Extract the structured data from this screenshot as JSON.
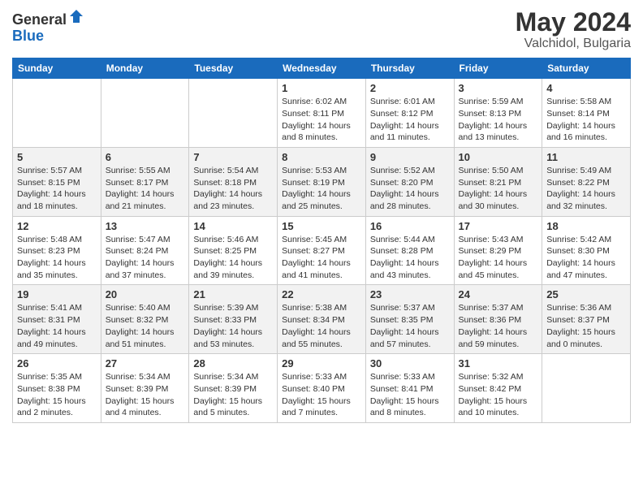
{
  "logo": {
    "general": "General",
    "blue": "Blue"
  },
  "header": {
    "month_year": "May 2024",
    "location": "Valchidol, Bulgaria"
  },
  "weekdays": [
    "Sunday",
    "Monday",
    "Tuesday",
    "Wednesday",
    "Thursday",
    "Friday",
    "Saturday"
  ],
  "weeks": [
    [
      {
        "day": "",
        "sunrise": "",
        "sunset": "",
        "daylight": ""
      },
      {
        "day": "",
        "sunrise": "",
        "sunset": "",
        "daylight": ""
      },
      {
        "day": "",
        "sunrise": "",
        "sunset": "",
        "daylight": ""
      },
      {
        "day": "1",
        "sunrise": "Sunrise: 6:02 AM",
        "sunset": "Sunset: 8:11 PM",
        "daylight": "Daylight: 14 hours and 8 minutes."
      },
      {
        "day": "2",
        "sunrise": "Sunrise: 6:01 AM",
        "sunset": "Sunset: 8:12 PM",
        "daylight": "Daylight: 14 hours and 11 minutes."
      },
      {
        "day": "3",
        "sunrise": "Sunrise: 5:59 AM",
        "sunset": "Sunset: 8:13 PM",
        "daylight": "Daylight: 14 hours and 13 minutes."
      },
      {
        "day": "4",
        "sunrise": "Sunrise: 5:58 AM",
        "sunset": "Sunset: 8:14 PM",
        "daylight": "Daylight: 14 hours and 16 minutes."
      }
    ],
    [
      {
        "day": "5",
        "sunrise": "Sunrise: 5:57 AM",
        "sunset": "Sunset: 8:15 PM",
        "daylight": "Daylight: 14 hours and 18 minutes."
      },
      {
        "day": "6",
        "sunrise": "Sunrise: 5:55 AM",
        "sunset": "Sunset: 8:17 PM",
        "daylight": "Daylight: 14 hours and 21 minutes."
      },
      {
        "day": "7",
        "sunrise": "Sunrise: 5:54 AM",
        "sunset": "Sunset: 8:18 PM",
        "daylight": "Daylight: 14 hours and 23 minutes."
      },
      {
        "day": "8",
        "sunrise": "Sunrise: 5:53 AM",
        "sunset": "Sunset: 8:19 PM",
        "daylight": "Daylight: 14 hours and 25 minutes."
      },
      {
        "day": "9",
        "sunrise": "Sunrise: 5:52 AM",
        "sunset": "Sunset: 8:20 PM",
        "daylight": "Daylight: 14 hours and 28 minutes."
      },
      {
        "day": "10",
        "sunrise": "Sunrise: 5:50 AM",
        "sunset": "Sunset: 8:21 PM",
        "daylight": "Daylight: 14 hours and 30 minutes."
      },
      {
        "day": "11",
        "sunrise": "Sunrise: 5:49 AM",
        "sunset": "Sunset: 8:22 PM",
        "daylight": "Daylight: 14 hours and 32 minutes."
      }
    ],
    [
      {
        "day": "12",
        "sunrise": "Sunrise: 5:48 AM",
        "sunset": "Sunset: 8:23 PM",
        "daylight": "Daylight: 14 hours and 35 minutes."
      },
      {
        "day": "13",
        "sunrise": "Sunrise: 5:47 AM",
        "sunset": "Sunset: 8:24 PM",
        "daylight": "Daylight: 14 hours and 37 minutes."
      },
      {
        "day": "14",
        "sunrise": "Sunrise: 5:46 AM",
        "sunset": "Sunset: 8:25 PM",
        "daylight": "Daylight: 14 hours and 39 minutes."
      },
      {
        "day": "15",
        "sunrise": "Sunrise: 5:45 AM",
        "sunset": "Sunset: 8:27 PM",
        "daylight": "Daylight: 14 hours and 41 minutes."
      },
      {
        "day": "16",
        "sunrise": "Sunrise: 5:44 AM",
        "sunset": "Sunset: 8:28 PM",
        "daylight": "Daylight: 14 hours and 43 minutes."
      },
      {
        "day": "17",
        "sunrise": "Sunrise: 5:43 AM",
        "sunset": "Sunset: 8:29 PM",
        "daylight": "Daylight: 14 hours and 45 minutes."
      },
      {
        "day": "18",
        "sunrise": "Sunrise: 5:42 AM",
        "sunset": "Sunset: 8:30 PM",
        "daylight": "Daylight: 14 hours and 47 minutes."
      }
    ],
    [
      {
        "day": "19",
        "sunrise": "Sunrise: 5:41 AM",
        "sunset": "Sunset: 8:31 PM",
        "daylight": "Daylight: 14 hours and 49 minutes."
      },
      {
        "day": "20",
        "sunrise": "Sunrise: 5:40 AM",
        "sunset": "Sunset: 8:32 PM",
        "daylight": "Daylight: 14 hours and 51 minutes."
      },
      {
        "day": "21",
        "sunrise": "Sunrise: 5:39 AM",
        "sunset": "Sunset: 8:33 PM",
        "daylight": "Daylight: 14 hours and 53 minutes."
      },
      {
        "day": "22",
        "sunrise": "Sunrise: 5:38 AM",
        "sunset": "Sunset: 8:34 PM",
        "daylight": "Daylight: 14 hours and 55 minutes."
      },
      {
        "day": "23",
        "sunrise": "Sunrise: 5:37 AM",
        "sunset": "Sunset: 8:35 PM",
        "daylight": "Daylight: 14 hours and 57 minutes."
      },
      {
        "day": "24",
        "sunrise": "Sunrise: 5:37 AM",
        "sunset": "Sunset: 8:36 PM",
        "daylight": "Daylight: 14 hours and 59 minutes."
      },
      {
        "day": "25",
        "sunrise": "Sunrise: 5:36 AM",
        "sunset": "Sunset: 8:37 PM",
        "daylight": "Daylight: 15 hours and 0 minutes."
      }
    ],
    [
      {
        "day": "26",
        "sunrise": "Sunrise: 5:35 AM",
        "sunset": "Sunset: 8:38 PM",
        "daylight": "Daylight: 15 hours and 2 minutes."
      },
      {
        "day": "27",
        "sunrise": "Sunrise: 5:34 AM",
        "sunset": "Sunset: 8:39 PM",
        "daylight": "Daylight: 15 hours and 4 minutes."
      },
      {
        "day": "28",
        "sunrise": "Sunrise: 5:34 AM",
        "sunset": "Sunset: 8:39 PM",
        "daylight": "Daylight: 15 hours and 5 minutes."
      },
      {
        "day": "29",
        "sunrise": "Sunrise: 5:33 AM",
        "sunset": "Sunset: 8:40 PM",
        "daylight": "Daylight: 15 hours and 7 minutes."
      },
      {
        "day": "30",
        "sunrise": "Sunrise: 5:33 AM",
        "sunset": "Sunset: 8:41 PM",
        "daylight": "Daylight: 15 hours and 8 minutes."
      },
      {
        "day": "31",
        "sunrise": "Sunrise: 5:32 AM",
        "sunset": "Sunset: 8:42 PM",
        "daylight": "Daylight: 15 hours and 10 minutes."
      },
      {
        "day": "",
        "sunrise": "",
        "sunset": "",
        "daylight": ""
      }
    ]
  ]
}
